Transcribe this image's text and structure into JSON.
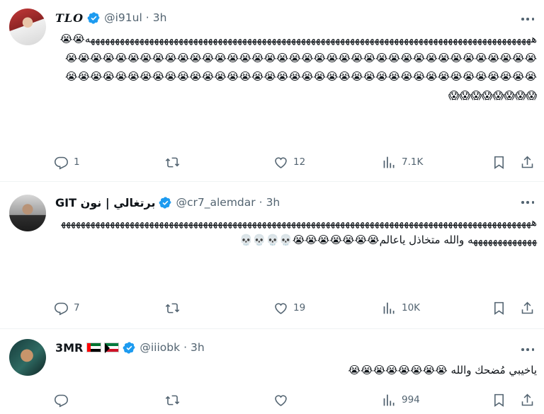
{
  "tweets": [
    {
      "name": "TLO",
      "handle": "@i91ul",
      "dot": "·",
      "time": "3h",
      "text": "هههههههههههههههههههههههههههههههههههههههههههههههههههههههههههههههههههههههههههههههههههههههههههه😭😭😭😭😭😭😭😭😭😭😭😭😭😭😭😭😭😭😭😭😭😭😭😭😭😭😭😭😭😭😭😭😭😭😭😭😭😭😭😭😭😭😭😭😭😭😭😭😭😭😭😭😭😭😭😭😭😭😭😭😭😭😭😭😭😭😭😭😭😭😭😭😭😭😭😭😭😭😱😱😱😱😱😱😱😱",
      "replies": "1",
      "retweets": "",
      "likes": "12",
      "views": "7.1K"
    },
    {
      "name": "GIT برتغالي | نون",
      "handle": "@cr7_alemdar",
      "dot": "·",
      "time": "3h",
      "text": "ههههههههههههههههههههههههههههههههههههههههههههههههههههههههههههههههههههههههههههههههههههههههههههههههههههههههههههههه والله متخاذل ياعالم😭😭😭😭😭😭😭💀💀💀💀",
      "replies": "7",
      "retweets": "",
      "likes": "19",
      "views": "10K"
    },
    {
      "name": "3MR",
      "handle": "@iiiobk",
      "dot": "·",
      "time": "3h",
      "text": "ياخيبي مُضحك والله 😭😭😭😭😭😭😭😭",
      "replies": "",
      "retweets": "",
      "likes": "",
      "views": "994"
    }
  ],
  "colors": {
    "text": "#0f1419",
    "secondary": "#536471",
    "verified": "#1d9bf0",
    "divider": "#eff3f4"
  },
  "icons": [
    "verified-badge-icon",
    "more-icon",
    "reply-icon",
    "retweet-icon",
    "like-icon",
    "views-icon",
    "bookmark-icon",
    "share-icon",
    "uae-flag-icon",
    "kuwait-flag-icon"
  ]
}
